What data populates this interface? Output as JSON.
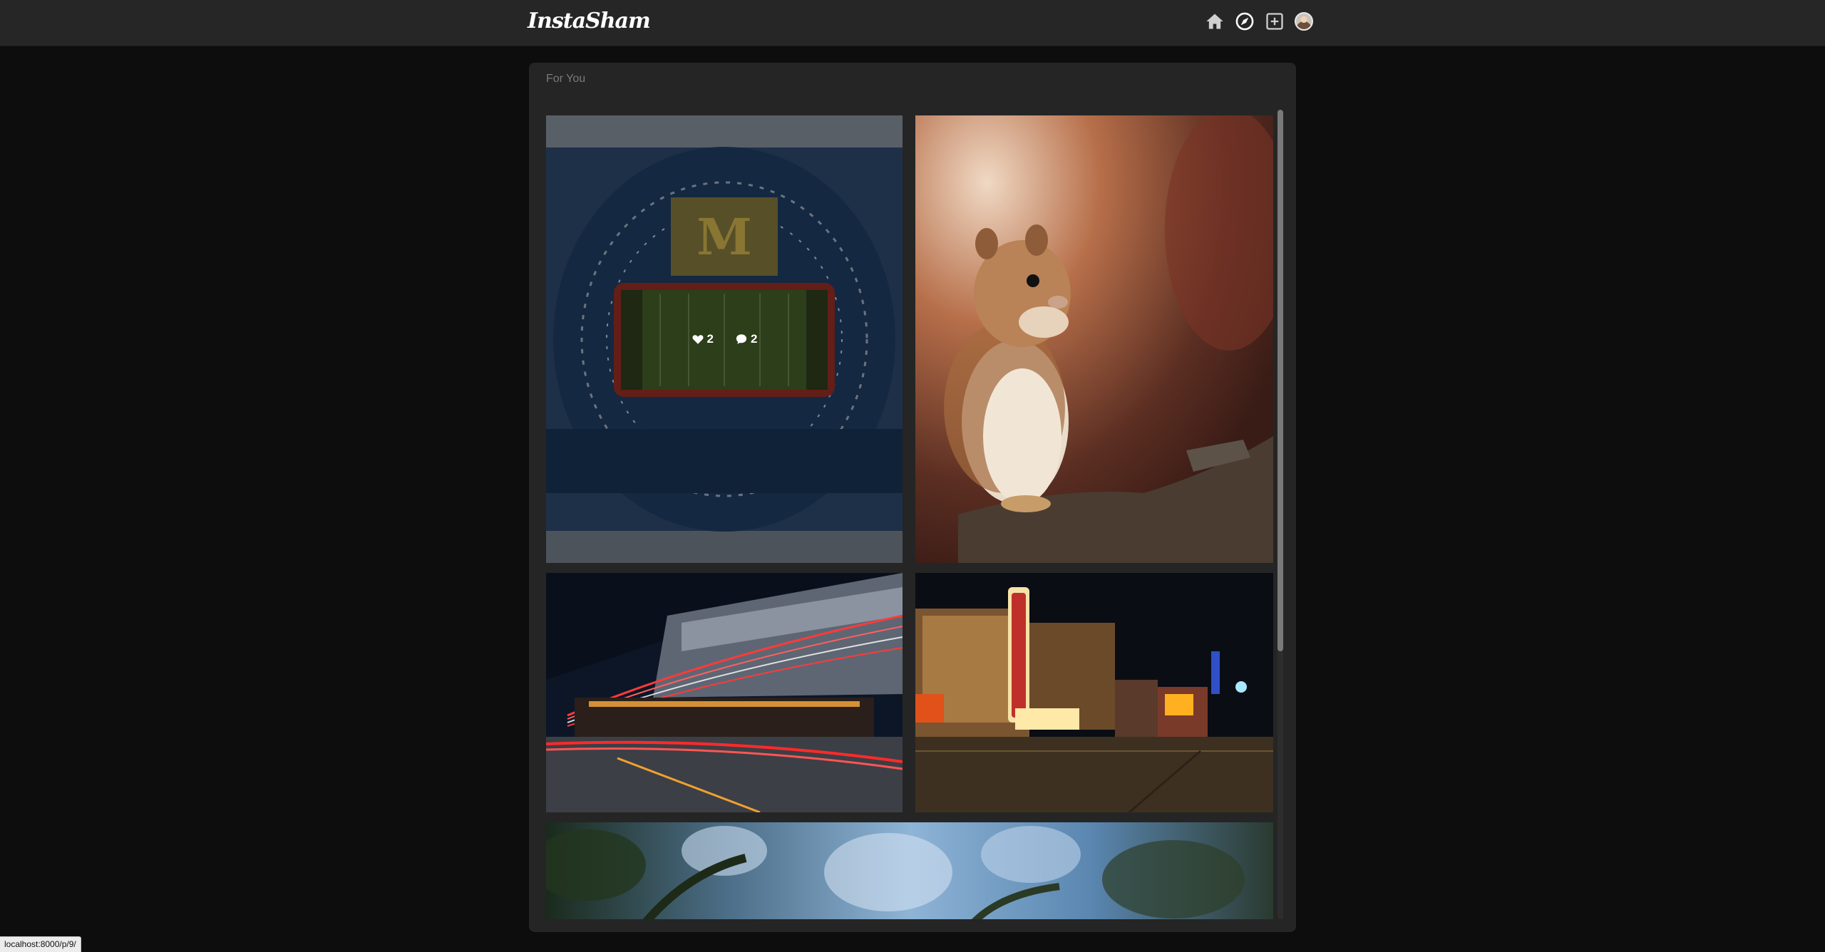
{
  "brand": {
    "logo": "InstaSham"
  },
  "nav": {
    "icons": [
      "home-icon",
      "explore-icon",
      "add-post-icon",
      "avatar"
    ]
  },
  "feed": {
    "title": "For You",
    "posts": [
      {
        "subject": "stadium",
        "likes": "2",
        "comments": "2",
        "hovered": true
      },
      {
        "subject": "chipmunk"
      },
      {
        "subject": "light-trails-street"
      },
      {
        "subject": "michigan-theater"
      },
      {
        "subject": "blue-flowers"
      }
    ]
  },
  "status": {
    "url": "localhost:8000/p/9/"
  },
  "colors": {
    "navbar": "#262626",
    "background": "#0d0d0d",
    "card": "#252525",
    "muted_text": "#7a7a7a"
  }
}
